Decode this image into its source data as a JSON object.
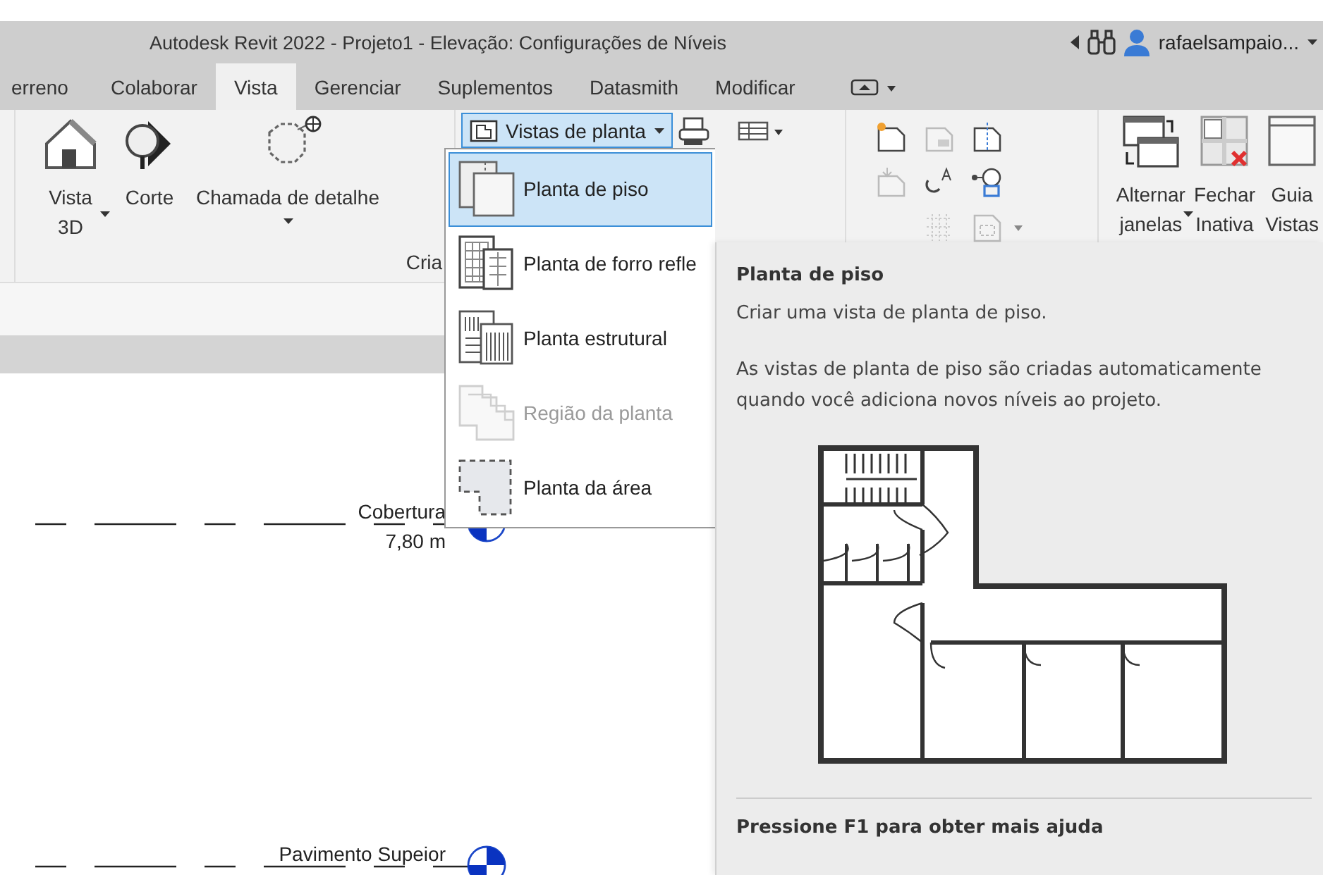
{
  "window": {
    "title": "Autodesk Revit 2022 - Projeto1 - Elevação: Configurações de Níveis"
  },
  "user": {
    "name": "rafaelsampaio...",
    "dropdown": true
  },
  "tabs": [
    {
      "label": "erreno",
      "selected": false
    },
    {
      "label": "Colaborar",
      "selected": false
    },
    {
      "label": "Vista",
      "selected": true
    },
    {
      "label": "Gerenciar",
      "selected": false
    },
    {
      "label": "Suplementos",
      "selected": false
    },
    {
      "label": "Datasmith",
      "selected": false
    },
    {
      "label": "Modificar",
      "selected": false
    }
  ],
  "create_panel": {
    "label": "Cria",
    "buttons": [
      {
        "kind": "view3d",
        "lines": [
          "Vista",
          "3D"
        ],
        "dropdown": true
      },
      {
        "kind": "section",
        "lines": [
          "Corte"
        ],
        "dropdown": false
      },
      {
        "kind": "callout",
        "lines": [
          "Chamada de detalhe"
        ],
        "dropdown": true
      }
    ]
  },
  "plan_views_button": {
    "label": "Vistas de planta",
    "expanded": true
  },
  "window_buttons": [
    {
      "kind": "switch",
      "lines": [
        "Alternar",
        "janelas"
      ],
      "dropdown": true
    },
    {
      "kind": "close",
      "lines": [
        "Fechar",
        "Inativa"
      ],
      "dropdown": false
    },
    {
      "kind": "tabs",
      "lines": [
        "Guia",
        "Vistas"
      ],
      "dropdown": false
    }
  ],
  "menu": {
    "items": [
      {
        "kind": "floor",
        "label": "Planta de piso",
        "selected": true,
        "disabled": false
      },
      {
        "kind": "ceiling",
        "label": "Planta de forro refle",
        "selected": false,
        "disabled": false
      },
      {
        "kind": "structural",
        "label": "Planta estrutural",
        "selected": false,
        "disabled": false
      },
      {
        "kind": "region",
        "label": "Região da planta",
        "selected": false,
        "disabled": true
      },
      {
        "kind": "area",
        "label": "Planta da área",
        "selected": false,
        "disabled": false
      }
    ]
  },
  "tooltip": {
    "title": "Planta de piso",
    "summary": "Criar uma vista de planta de piso.",
    "details": "As vistas de planta de piso são criadas automaticamente quando você adiciona novos níveis ao projeto.",
    "footer": "Pressione F1 para obter mais ajuda"
  },
  "levels": [
    {
      "name": "Cobertura",
      "elevation": "7,80 m"
    },
    {
      "name": "Pavimento Supeior"
    }
  ]
}
